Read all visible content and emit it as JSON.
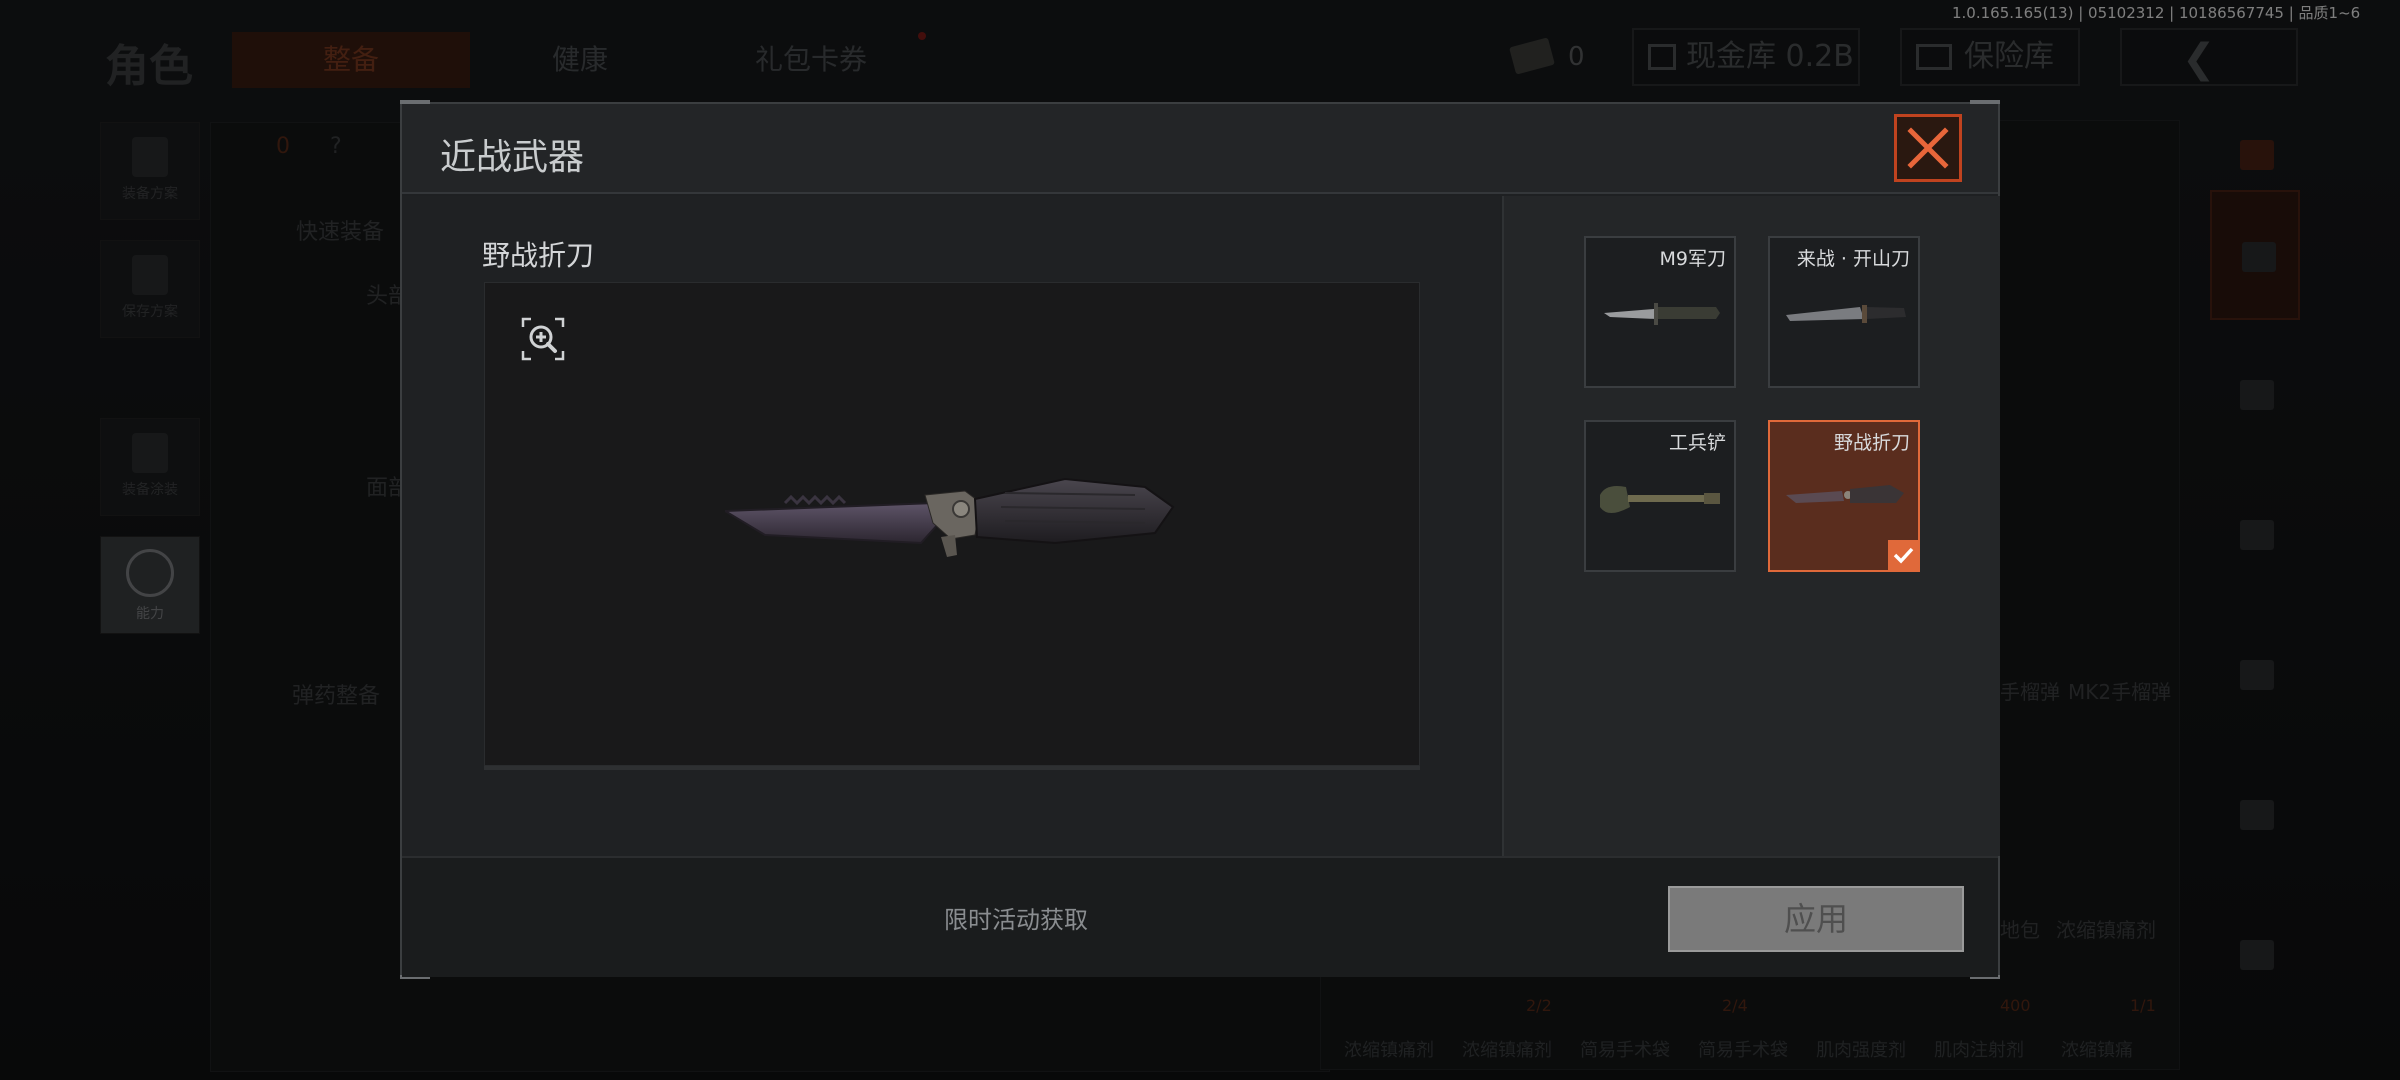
{
  "background": {
    "title": "角色",
    "tabs": [
      "整备",
      "健康",
      "礼包卡券"
    ],
    "version_info": "1.0.165.165(13) | 05102312 | 10186567745 | 品质1~6",
    "money_value": "0",
    "cash_label": "现金库 0.2B",
    "safe_label": "保险库",
    "left_buttons": [
      "装备方案",
      "保存方案",
      "装备涂装",
      "能力"
    ],
    "count_value": "0",
    "help_label": "?",
    "quick_equip": "快速装备",
    "head_label": "头部",
    "face_label": "面部",
    "ammo_equip": "弹药整备",
    "grenade_1": "手榴弹",
    "grenade_2": "MK2手榴弹",
    "item_label_1": "地包",
    "item_label_2": "浓缩镇痛剂",
    "counts": [
      "2/2",
      "2/4",
      "400",
      "1/1"
    ],
    "bottom_labels": [
      "浓缩镇痛剂",
      "浓缩镇痛剂",
      "简易手术袋",
      "简易手术袋",
      "肌肉强度剂",
      "肌肉注射剂",
      "浓缩镇痛"
    ]
  },
  "modal": {
    "title": "近战武器",
    "selected_item_name": "野战折刀",
    "acquire_text": "限时活动获取",
    "apply_label": "应用",
    "cards": [
      {
        "name": "M9军刀",
        "selected": false
      },
      {
        "name": "来战 · 开山刀",
        "selected": false
      },
      {
        "name": "工兵铲",
        "selected": false
      },
      {
        "name": "野战折刀",
        "selected": true
      }
    ]
  },
  "colors": {
    "accent": "#e0693a",
    "modal_bg": "#1e2022",
    "apply_disabled": "#7a7a7a"
  }
}
